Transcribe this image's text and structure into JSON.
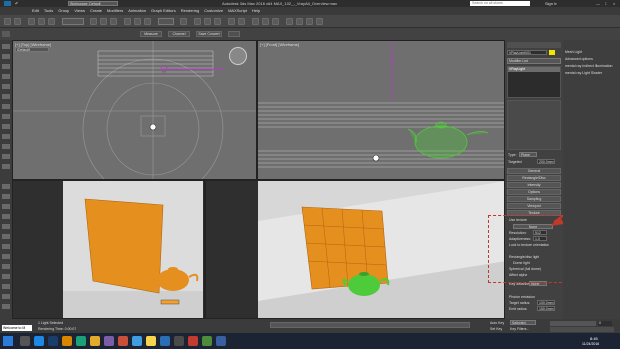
{
  "app": {
    "title": "Autodesk 3ds Max 2016 x64    MAX_102_-_VrayAlt_Overview.max",
    "workspace": "Workspace: Default",
    "search_placeholder": "Search on all stores",
    "signin": "Sign In"
  },
  "menu": [
    "Edit",
    "Tools",
    "Group",
    "Views",
    "Create",
    "Modifiers",
    "Animation",
    "Graph Editors",
    "Rendering",
    "Customize",
    "MAXScript",
    "Help"
  ],
  "toolbar2": {
    "label_a": "Measure",
    "label_b": "Channel",
    "label_c": "Save Convert"
  },
  "viewports": {
    "top": {
      "label": "[+] [Top] [Wireframe]"
    },
    "front": {
      "label": "[+] [Front] [Wireframe]"
    },
    "camera1": {
      "label": "[+] [Camera01] [Shaded]"
    },
    "perspective": {
      "label": "[+] [Perspective] [Realistic]"
    },
    "default_dropdown": "[Default]"
  },
  "command_panel": {
    "object_name": "VRayLight001",
    "modifier_list": "Modifier List",
    "stack_item": "VRayLight",
    "rollouts": [
      "General",
      "Rectangle/Disc",
      "Intensity",
      "Options",
      "Sampling",
      "Viewport",
      "Advanced options",
      "Mental ray Indirect Illumination",
      "mental ray Light Shader"
    ],
    "type_label": "Type:",
    "type_value": "Plane",
    "targeted": "Targeted",
    "target_dist": "200.0mm",
    "texture_header": "Texture",
    "use_texture": "Use texture",
    "texture_none": "None",
    "resolution_label": "Resolution:",
    "resolution_value": "512",
    "adaptiveness_label": "Adaptiveness:",
    "adaptiveness_value": "1.0",
    "lock_direction": "Lock to texture orientation",
    "rect_disc_light": "Rectangle/disc light",
    "dome_light": "Dome light",
    "spherical": "Spherical (full dome)",
    "affect_alpha": "Affect alpha",
    "ray_dist": "Ray distance",
    "ray_value": "None",
    "photon_emission": "Photon emission",
    "target_radius_label": "Target radius:",
    "target_radius": "100.0mm",
    "emit_radius_label": "Emit radius:",
    "emit_radius": "150.0mm"
  },
  "right_panel": {
    "items": [
      "Mesh Light",
      "Advanced options",
      "mental ray Indirect Illumination",
      "mental ray Light Shader"
    ]
  },
  "annotation": {
    "number": "1"
  },
  "status": {
    "welcome": "Welcome to M",
    "selected": "1 Light Selected",
    "render_time": "Rendering Time: 0:00:07",
    "autokey": "Auto Key",
    "selected_dropdown": "Selected",
    "setkey": "Set Key",
    "keyfilters": "Key Filters...",
    "time_value": "0"
  },
  "taskbar": {
    "time": "8:45",
    "date": "11/24/2016",
    "search": "Search the web and Windows"
  },
  "colors": {
    "accent": "#f3a12e",
    "wall": "#e58f1e",
    "teapot_green": "#4ecb3a",
    "annotation_red": "#c0392b"
  }
}
